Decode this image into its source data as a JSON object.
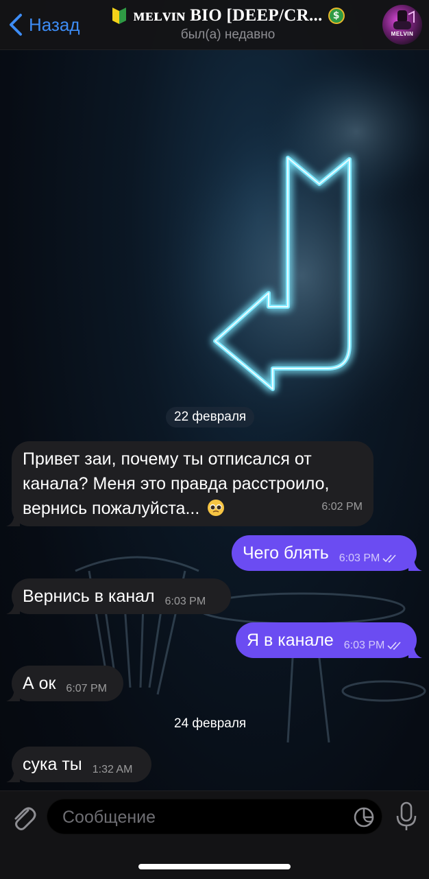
{
  "header": {
    "back_label": "Назад",
    "title": "ᴍᴇʟᴠɪɴ BIO [DEEP/CR...",
    "status": "был(а) недавно",
    "avatar_text": "MELVIN"
  },
  "messages": [
    {
      "kind": "date",
      "text": "22 февраля"
    },
    {
      "kind": "in",
      "text": "Привет заи, почему ты отписался от канала? Меня это правда расстроило, вернись пожалуйста...",
      "emoji": "pleading-face",
      "time": "6:02 PM"
    },
    {
      "kind": "out",
      "text": "Чего блять",
      "time": "6:03 PM",
      "read": true
    },
    {
      "kind": "in",
      "text": "Вернись в канал",
      "time": "6:03 PM"
    },
    {
      "kind": "out",
      "text": "Я в канале",
      "time": "6:03 PM",
      "read": true
    },
    {
      "kind": "in",
      "text": "А ок",
      "time": "6:07 PM"
    },
    {
      "kind": "date",
      "text": "24 февраля"
    },
    {
      "kind": "in",
      "text": "сука ты",
      "time": "1:32 AM"
    }
  ],
  "composer": {
    "placeholder": "Сообщение"
  },
  "colors": {
    "accent": "#3d8cf5",
    "outgoing_bubble": "#6b4cf2",
    "incoming_bubble": "#1f1f22",
    "neon": "#7fe9ff"
  },
  "icons": [
    "back-chevron-icon",
    "beginner-shield-icon",
    "dollar-icon",
    "paperclip-icon",
    "sticker-icon",
    "microphone-icon",
    "double-check-icon",
    "pleading-face-emoji"
  ]
}
